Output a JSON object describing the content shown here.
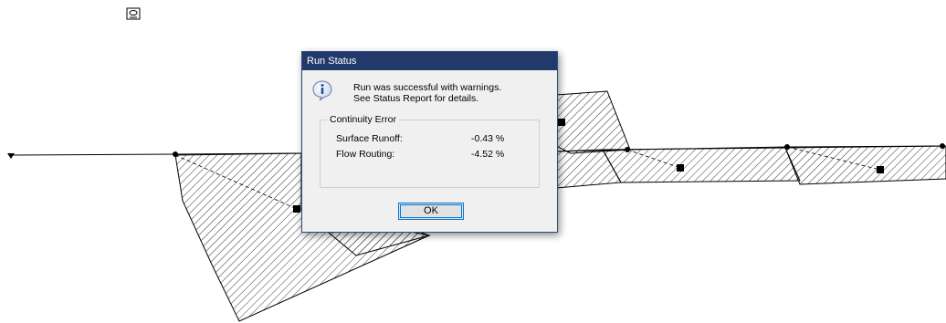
{
  "dialog": {
    "title": "Run Status",
    "message_line1": "Run was successful with warnings.",
    "message_line2": "See Status Report for details.",
    "group_title": "Continuity Error",
    "rows": [
      {
        "label": "Surface Runoff:",
        "value": "-0.43 %"
      },
      {
        "label": "Flow Routing:",
        "value": "-4.52 %"
      }
    ],
    "ok_label": "OK"
  },
  "colors": {
    "titlebar": "#22396b",
    "dialog_bg": "#f0f0f0",
    "button_focus": "#0078d7"
  },
  "icons": {
    "dialog_icon": "info-icon",
    "map_legend_icon": "rain-gage-icon"
  }
}
